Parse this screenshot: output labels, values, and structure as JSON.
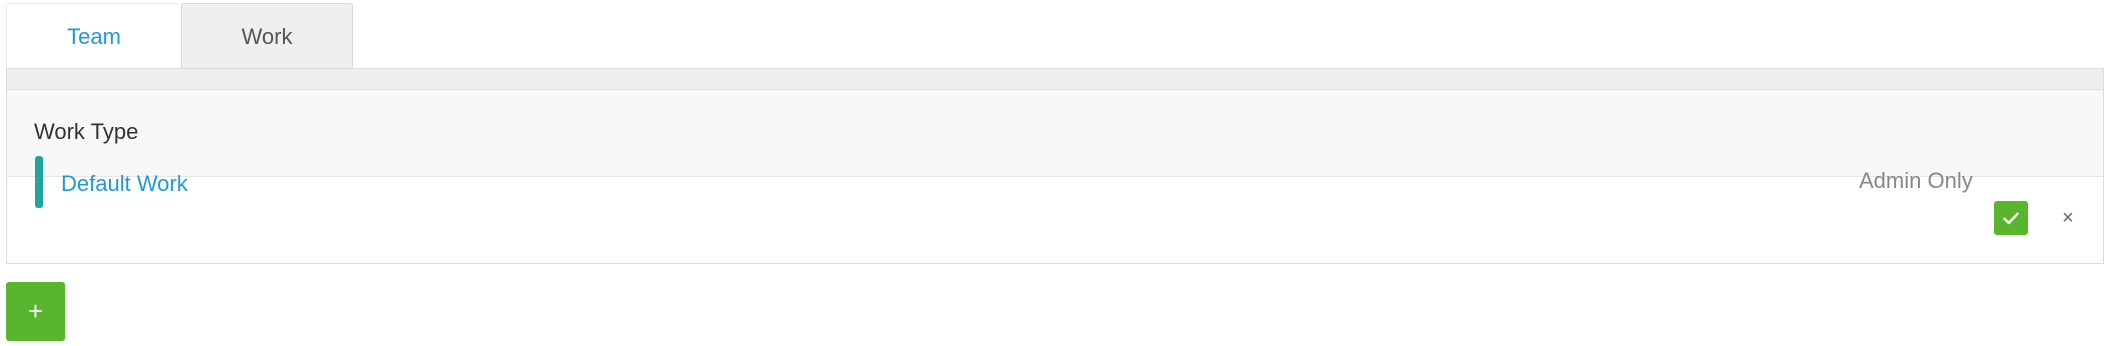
{
  "tabs": [
    {
      "label": "Team",
      "active": false
    },
    {
      "label": "Work",
      "active": true
    }
  ],
  "panel": {
    "header_label": "Work Type",
    "rows": [
      {
        "label": "Default Work",
        "color": "#1fa59c",
        "status_text": "Admin Only",
        "checked": true
      }
    ]
  },
  "actions": {
    "add_label": "+",
    "close_glyph": "×"
  },
  "colors": {
    "accent": "#1e9bd7",
    "success": "#5ab52e",
    "row_color": "#1fa59c"
  },
  "icons": {
    "check": "check-icon",
    "close": "close-icon",
    "add": "plus-icon"
  }
}
